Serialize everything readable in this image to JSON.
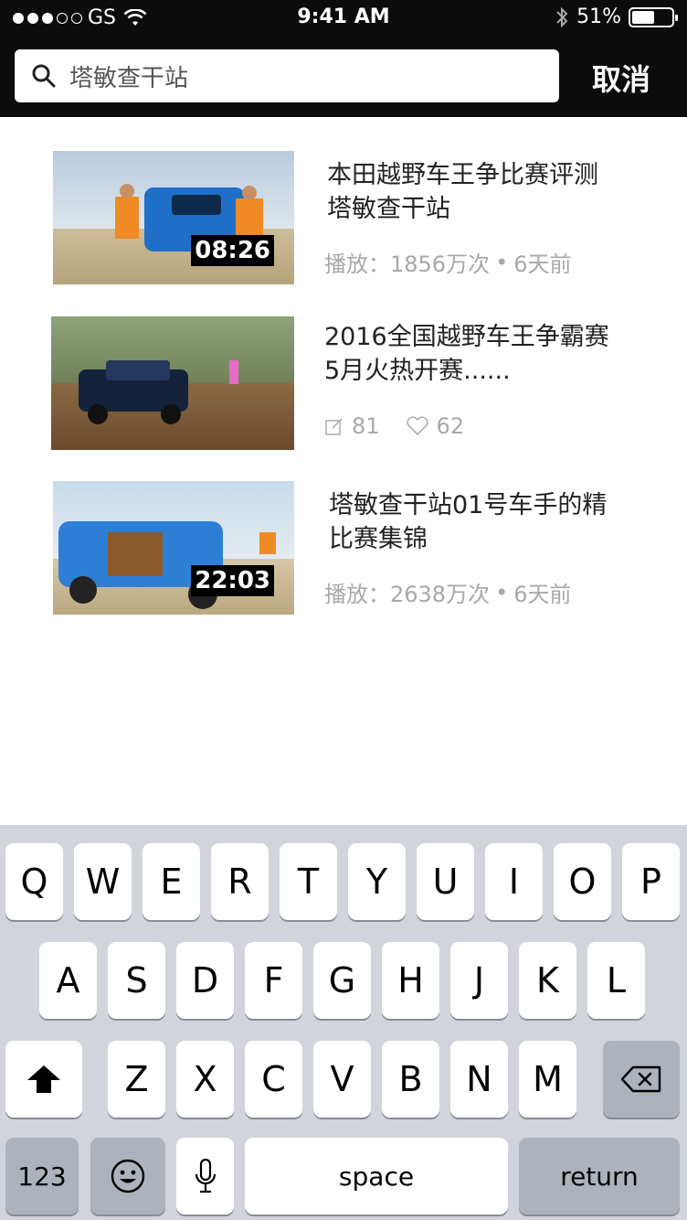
{
  "status_bar": {
    "carrier": "GS",
    "time": "9:41 AM",
    "battery": "51%"
  },
  "search": {
    "query": "塔敏查干站",
    "cancel_label": "取消"
  },
  "results": [
    {
      "title_line1": "本田越野车王争比赛评测",
      "title_line2": "塔敏查干站",
      "duration": "08:26",
      "plays": "播放：1856万次",
      "age": "6天前"
    },
    {
      "title_line1": "2016全国越野车王争霸赛",
      "title_line2": "5月火热开赛......",
      "comments": "81",
      "likes": "62"
    },
    {
      "title_line1": "塔敏查干站01号车手的精",
      "title_line2": "比赛集锦",
      "duration": "22:03",
      "plays": "播放：2638万次",
      "age": "6天前"
    }
  ],
  "keyboard": {
    "row1": [
      "Q",
      "W",
      "E",
      "R",
      "T",
      "Y",
      "U",
      "I",
      "O",
      "P"
    ],
    "row2": [
      "A",
      "S",
      "D",
      "F",
      "G",
      "H",
      "J",
      "K",
      "L"
    ],
    "row3": [
      "Z",
      "X",
      "C",
      "V",
      "B",
      "N",
      "M"
    ],
    "numbers_label": "123",
    "space_label": "space",
    "return_label": "return"
  },
  "icons": {
    "search": "search-icon",
    "wifi": "wifi-icon",
    "bluetooth": "bluetooth-icon",
    "battery": "battery-icon",
    "comment": "comment-icon",
    "like": "heart-icon",
    "shift": "shift-icon",
    "delete": "delete-icon",
    "emoji": "emoji-icon",
    "mic": "microphone-icon"
  }
}
